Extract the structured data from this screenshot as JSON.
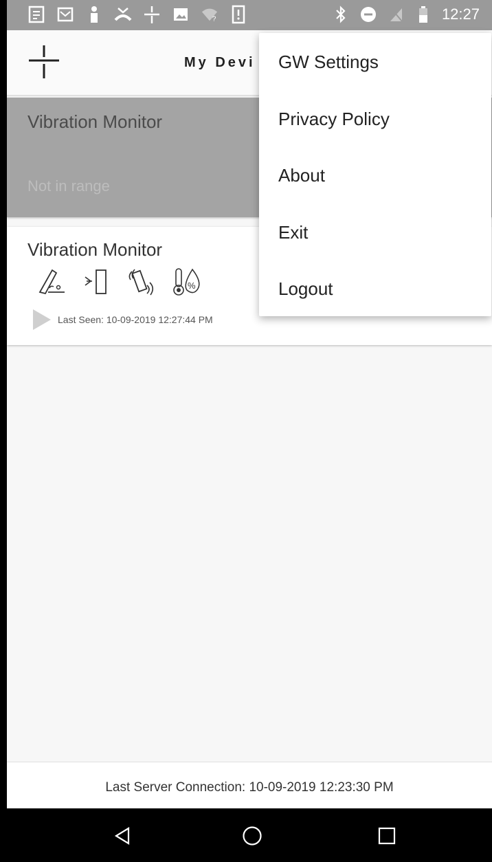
{
  "status_bar": {
    "time": "12:27",
    "left_icons": [
      "notes-icon",
      "mail-icon",
      "person-icon",
      "missed-call-icon",
      "app-logo-icon",
      "image-icon",
      "wifi-question-icon",
      "phone-alert-icon"
    ],
    "right_icons": [
      "bluetooth-icon",
      "do-not-disturb-icon",
      "no-sim-icon",
      "battery-icon"
    ]
  },
  "app_bar": {
    "title": "My Devi"
  },
  "devices": [
    {
      "name": "Vibration Monitor",
      "status": "Not in range"
    },
    {
      "name": "Vibration Monitor",
      "last_seen": "Last Seen: 10-09-2019 12:27:44 PM",
      "sensor_icons": [
        "tilt-sensor-icon",
        "proximity-sensor-icon",
        "vibration-sensor-icon",
        "temperature-humidity-icon"
      ]
    }
  ],
  "menu": {
    "items": [
      "GW Settings",
      "Privacy Policy",
      "About",
      "Exit",
      "Logout"
    ]
  },
  "footer": {
    "last_connection": "Last Server Connection: 10-09-2019 12:23:30 PM"
  },
  "colors": {
    "status_bar": "#9a9a9a",
    "offline_card": "#a4a4a4",
    "background": "#f7f7f7"
  }
}
